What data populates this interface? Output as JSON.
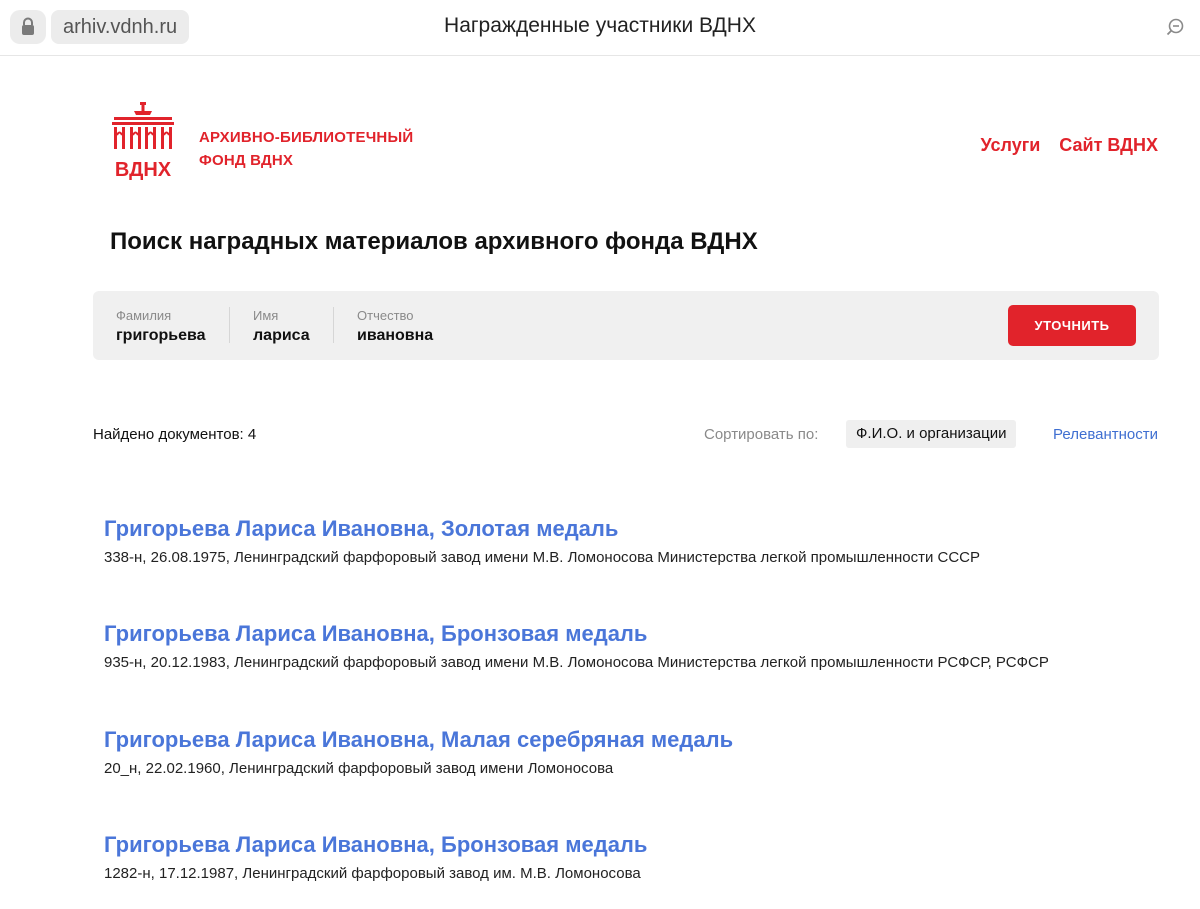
{
  "browser": {
    "url": "arhiv.vdnh.ru",
    "tab_title": "Награжденные участники ВДНХ"
  },
  "header": {
    "logo_text": "ВДНХ",
    "brand_line1": "АРХИВНО-БИБЛИОТЕЧНЫЙ",
    "brand_line2": "ФОНД ВДНХ",
    "nav": [
      "Услуги",
      "Сайт ВДНХ"
    ]
  },
  "page_title": "Поиск наградных материалов архивного фонда ВДНХ",
  "search": {
    "fields": [
      {
        "label": "Фамилия",
        "value": "григорьева"
      },
      {
        "label": "Имя",
        "value": "лариса"
      },
      {
        "label": "Отчество",
        "value": "ивановна"
      }
    ],
    "button_label": "УТОЧНИТЬ"
  },
  "results_meta": {
    "found_text": "Найдено документов: 4",
    "sort_label": "Сортировать по:",
    "sort_active": "Ф.И.О. и организации",
    "sort_alt": "Релевантности"
  },
  "results": [
    {
      "title": "Григорьева Лариса Ивановна, Золотая медаль",
      "desc": "338-н, 26.08.1975, Ленинградский фарфоровый завод имени М.В. Ломоносова Министерства легкой промышленности СССР"
    },
    {
      "title": "Григорьева Лариса Ивановна, Бронзовая медаль",
      "desc": "935-н, 20.12.1983, Ленинградский фарфоровый завод имени М.В. Ломоносова Министерства легкой промышленности РСФСР, РСФСР"
    },
    {
      "title": "Григорьева Лариса Ивановна, Малая серебряная медаль",
      "desc": "20_н, 22.02.1960, Ленинградский фарфоровый завод имени Ломоносова"
    },
    {
      "title": "Григорьева Лариса Ивановна, Бронзовая медаль",
      "desc": "1282-н, 17.12.1987, Ленинградский фарфоровый завод им. М.В. Ломоносова"
    }
  ],
  "colors": {
    "brand_red": "#e1232b",
    "link_blue": "#4a76d9"
  },
  "icons": {
    "lock": "lock-icon",
    "zoom": "zoom-out-icon",
    "logo": "vdnh-arch-logo"
  }
}
